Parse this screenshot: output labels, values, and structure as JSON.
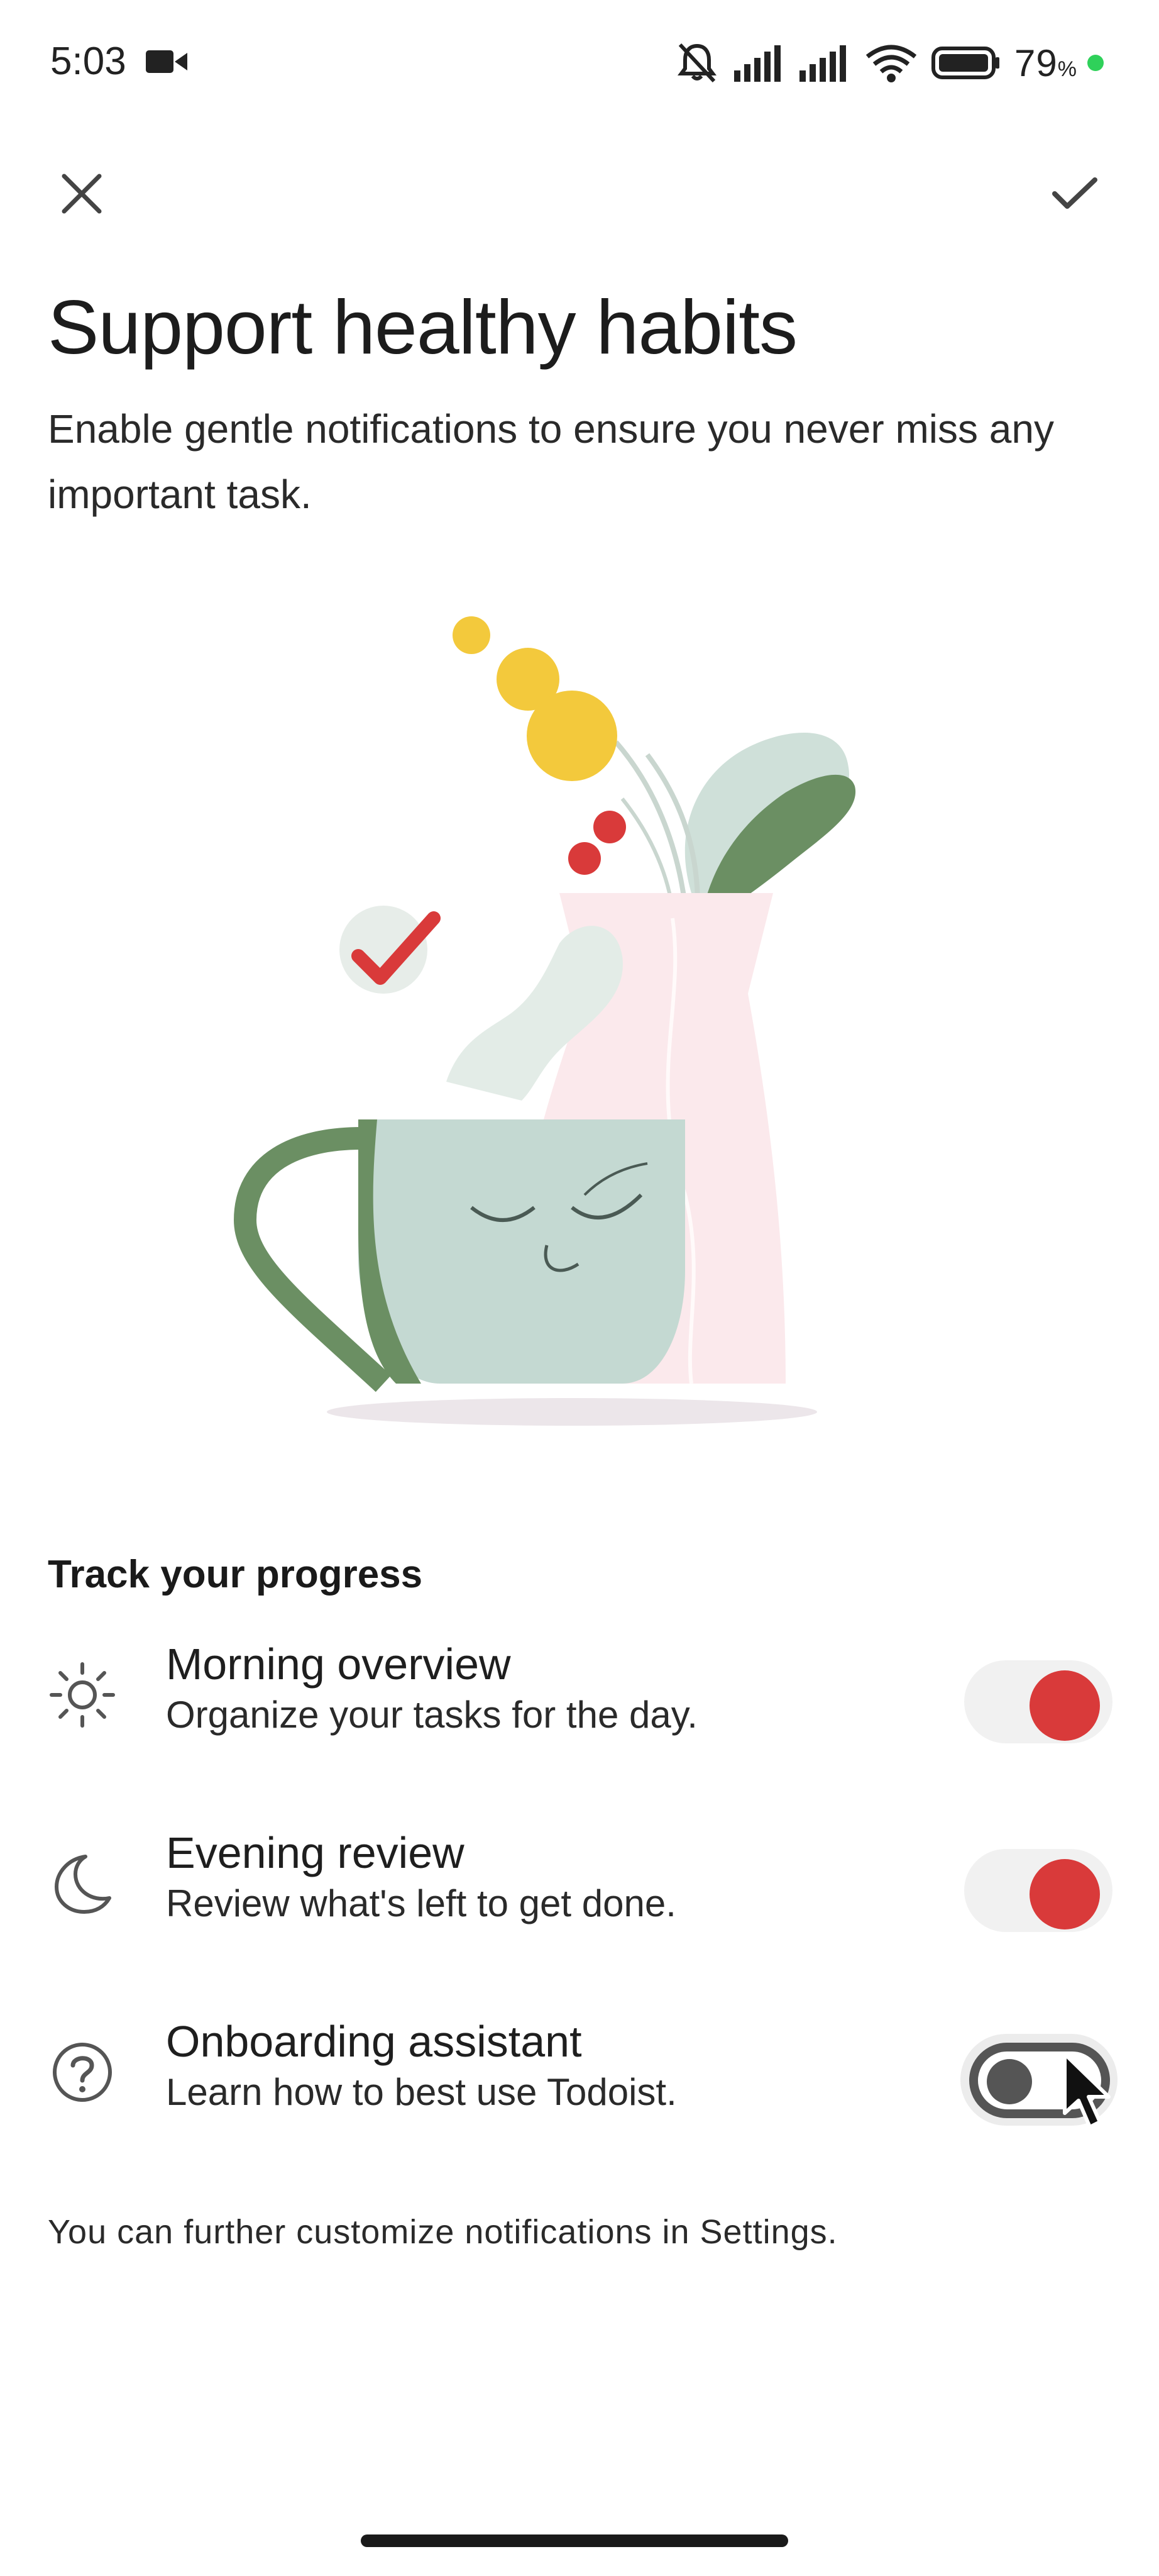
{
  "status_bar": {
    "time": "5:03",
    "battery_percent": "79",
    "battery_unit": "%",
    "icons": [
      "video-camera-icon",
      "muted-bell-icon",
      "signal-icon",
      "signal-icon",
      "wifi-icon",
      "battery-icon"
    ]
  },
  "header": {
    "close_icon": "close-icon",
    "confirm_icon": "check-icon"
  },
  "intro": {
    "title": "Support healthy habits",
    "subtitle": "Enable gentle notifications to ensure you never miss any important task."
  },
  "section": {
    "title": "Track your progress",
    "items": [
      {
        "icon": "sun-icon",
        "title": "Morning overview",
        "description": "Organize your tasks for the day.",
        "enabled": true
      },
      {
        "icon": "moon-icon",
        "title": "Evening review",
        "description": "Review what's left to get done.",
        "enabled": true
      },
      {
        "icon": "help-circle-icon",
        "title": "Onboarding assistant",
        "description": "Learn how to best use Todoist.",
        "enabled": false
      }
    ]
  },
  "footer": {
    "note": "You can further customize notifications in Settings."
  },
  "colors": {
    "accent": "#d93a3a",
    "toggle_off": "#555555",
    "background": "#ffffff"
  }
}
